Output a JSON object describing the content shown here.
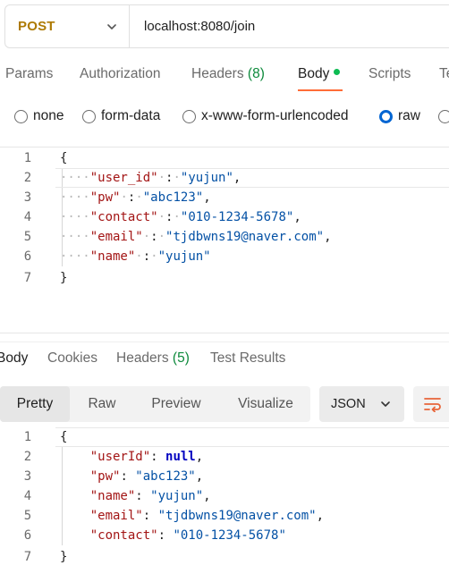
{
  "request": {
    "method": "POST",
    "url": "localhost:8080/join"
  },
  "request_tabs": [
    {
      "label": "Params"
    },
    {
      "label": "Authorization"
    },
    {
      "label": "Headers",
      "count": "(8)"
    },
    {
      "label": "Body"
    },
    {
      "label": "Scripts"
    },
    {
      "label": "Te"
    }
  ],
  "body_types": {
    "none": "none",
    "form_data": "form-data",
    "urlencoded": "x-www-form-urlencoded",
    "raw": "raw",
    "selected": "raw"
  },
  "request_body": {
    "line_numbers": [
      "1",
      "2",
      "3",
      "4",
      "5",
      "6",
      "7"
    ],
    "open": "{",
    "close": "}",
    "lines": [
      {
        "key": "\"user_id\"",
        "value": "\"yujun\"",
        "trail": ","
      },
      {
        "key": "\"pw\"",
        "value": "\"abc123\"",
        "trail": ","
      },
      {
        "key": "\"contact\"",
        "value": "\"010-1234-5678\"",
        "trail": ","
      },
      {
        "key": "\"email\"",
        "value": "\"tjdbwns19@naver.com\"",
        "trail": ","
      },
      {
        "key": "\"name\"",
        "value": "\"yujun\"",
        "trail": ""
      }
    ]
  },
  "response_tabs": [
    {
      "label": "Body"
    },
    {
      "label": "Cookies"
    },
    {
      "label": "Headers",
      "count": "(5)"
    },
    {
      "label": "Test Results"
    }
  ],
  "response_view": {
    "modes": [
      "Pretty",
      "Raw",
      "Preview",
      "Visualize"
    ],
    "active_mode": "Pretty",
    "format": "JSON"
  },
  "response_body": {
    "line_numbers": [
      "1",
      "2",
      "3",
      "4",
      "5",
      "6",
      "7"
    ],
    "open": "{",
    "close": "}",
    "lines": [
      {
        "key": "\"userId\"",
        "value": "null",
        "trail": ","
      },
      {
        "key": "\"pw\"",
        "value": "\"abc123\"",
        "trail": ","
      },
      {
        "key": "\"name\"",
        "value": "\"yujun\"",
        "trail": ","
      },
      {
        "key": "\"email\"",
        "value": "\"tjdbwns19@naver.com\"",
        "trail": ","
      },
      {
        "key": "\"contact\"",
        "value": "\"010-1234-5678\"",
        "trail": ""
      }
    ]
  },
  "colors": {
    "method": "#ad7a03",
    "accent": "#ff6c37",
    "active_dot": "#0cbb52",
    "radio_checked": "#0265d2",
    "json_key": "#a31515",
    "json_string": "#0451a5"
  },
  "icons": {
    "method_dropdown": "chevron-down-icon",
    "format_dropdown": "chevron-down-icon",
    "wrap": "wrap-lines-icon"
  }
}
